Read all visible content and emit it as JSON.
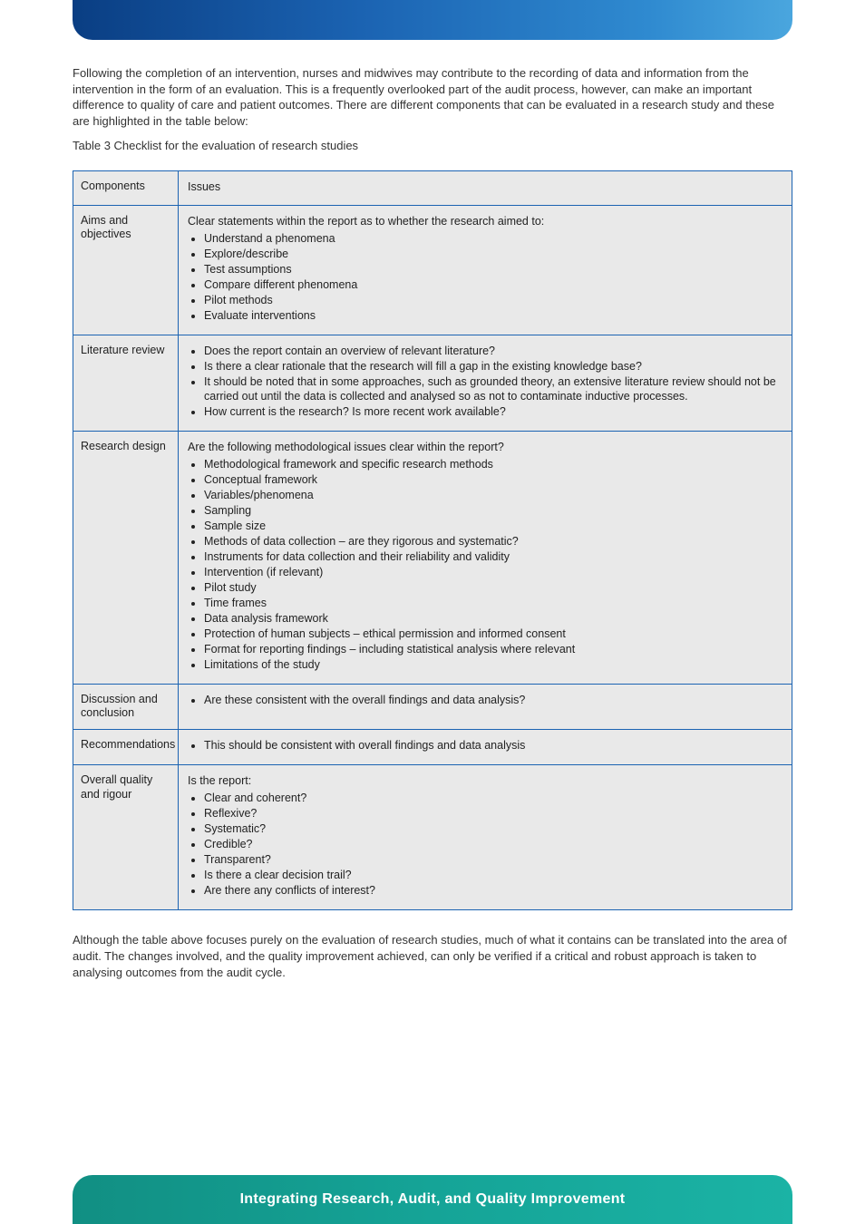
{
  "intro": {
    "p1": "Following the completion of an intervention, nurses and midwives may contribute to the recording of data and information from the intervention in the form of an evaluation. This is a frequently overlooked part of the audit process, however, can make an important difference to quality of care and patient outcomes. There are different components that can be evaluated in a research study and these are highlighted in the table below:",
    "table_caption": "Table 3 Checklist for the evaluation of research studies"
  },
  "table": {
    "header": {
      "left": "Components",
      "right": "Issues"
    },
    "rows": [
      {
        "left": "Aims and objectives",
        "preamble": "Clear statements within the report as to whether the research aimed to:",
        "items": [
          "Understand a phenomena",
          "Explore/describe",
          "Test assumptions",
          "Compare different phenomena",
          "Pilot methods",
          "Evaluate interventions"
        ]
      },
      {
        "left": "Literature review",
        "preamble": "",
        "items": [
          "Does the report contain an overview of relevant literature?",
          "Is there a clear rationale that the research will fill a gap in the existing knowledge base?",
          "It should be noted that in some approaches, such as grounded theory, an extensive literature review should not be carried out until the data is collected and analysed so as not to contaminate inductive processes.",
          "How current is the research? Is more recent work available?"
        ]
      },
      {
        "left": "Research design",
        "preamble": "Are the following methodological issues clear within the report?",
        "items": [
          "Methodological framework and specific research methods",
          "Conceptual framework",
          "Variables/phenomena",
          "Sampling",
          "Sample size",
          "Methods of data collection – are they rigorous and systematic?",
          "Instruments for data collection and their reliability and validity",
          "Intervention (if relevant)",
          "Pilot study",
          "Time frames",
          "Data analysis framework",
          "Protection of human subjects – ethical permission and informed consent",
          "Format for reporting findings – including statistical analysis where relevant",
          "Limitations of the study"
        ]
      },
      {
        "left": "Discussion and conclusion",
        "preamble": "",
        "items": [
          "Are these consistent with the overall findings and data analysis?"
        ]
      },
      {
        "left": "Recommendations",
        "preamble": "",
        "items": [
          "This should be consistent with overall findings and data analysis"
        ]
      },
      {
        "left": "Overall quality and rigour",
        "preamble": "Is the report:",
        "items": [
          "Clear and coherent?",
          "Reflexive?",
          "Systematic?",
          "Credible?",
          "Transparent?",
          "Is there a clear decision trail?",
          "Are there any conflicts of interest?"
        ]
      }
    ]
  },
  "outro": "Although the table above focuses purely on the evaluation of research studies, much of what it contains can be translated into the area of audit. The changes involved, and the quality improvement achieved, can only be verified if a critical and robust approach is taken to analysing outcomes from the audit cycle.",
  "footer": "Integrating Research, Audit, and Quality Improvement"
}
